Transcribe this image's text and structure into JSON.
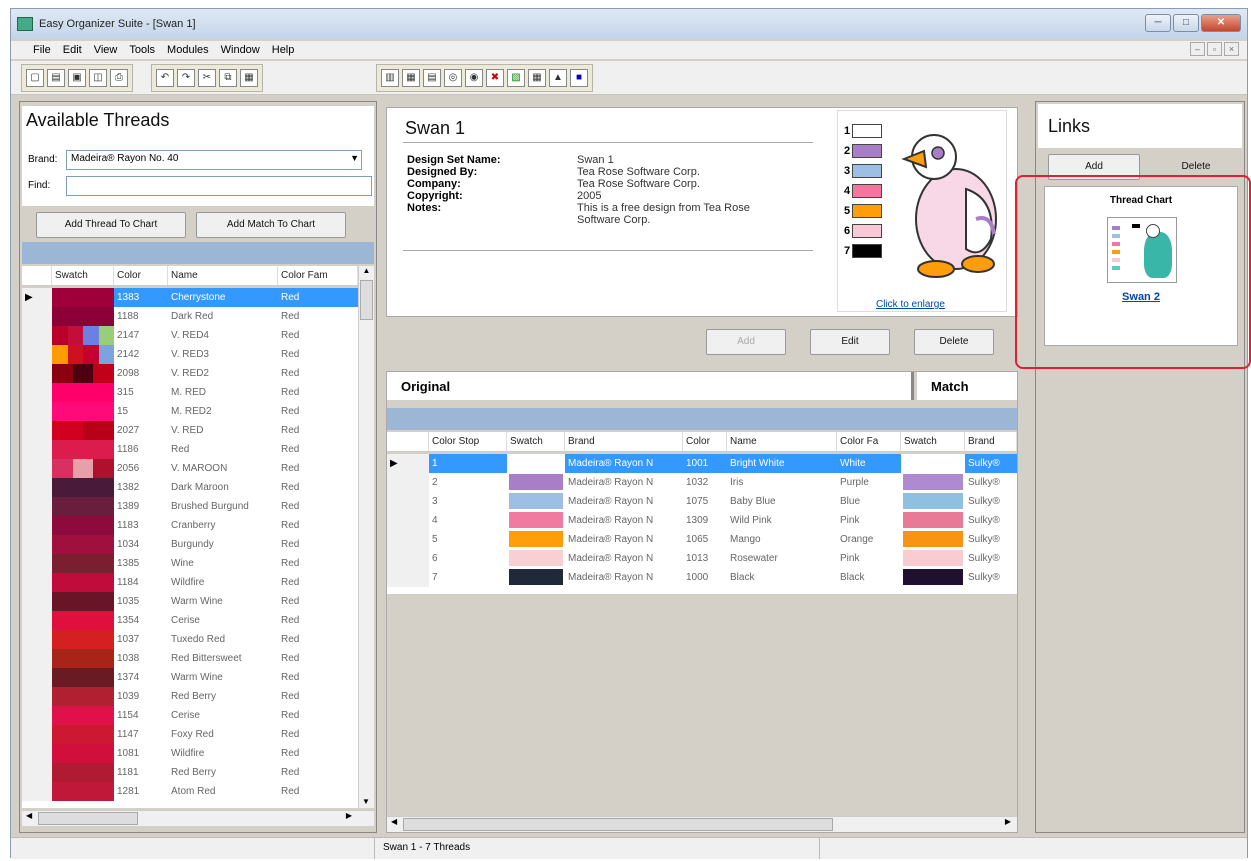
{
  "window": {
    "title": "Easy Organizer Suite - [Swan 1]"
  },
  "menu": [
    "File",
    "Edit",
    "View",
    "Tools",
    "Modules",
    "Window",
    "Help"
  ],
  "left": {
    "title": "Available Threads",
    "brand_label": "Brand:",
    "brand_value": "Madeira® Rayon No. 40",
    "find_label": "Find:",
    "add_thread": "Add Thread To Chart",
    "add_match": "Add Match To Chart",
    "columns": [
      "Swatch",
      "Color",
      "Name",
      "Color Fam"
    ],
    "rows": [
      {
        "swatch": [
          "#a0003a"
        ],
        "color": "1383",
        "name": "Cherrystone",
        "fam": "Red",
        "sel": true
      },
      {
        "swatch": [
          "#8c0038"
        ],
        "color": "1188",
        "name": "Dark Red",
        "fam": "Red"
      },
      {
        "swatch": [
          "#b8002a",
          "#c30d3a",
          "#6d7fe0",
          "#9acd79"
        ],
        "color": "2147",
        "name": "V. RED4",
        "fam": "Red"
      },
      {
        "swatch": [
          "#ff9a00",
          "#cf1020",
          "#c6002e",
          "#7aa3e0"
        ],
        "color": "2142",
        "name": "V. RED3",
        "fam": "Red"
      },
      {
        "swatch": [
          "#8b0010",
          "#4d0010",
          "#c00018"
        ],
        "color": "2098",
        "name": "V. RED2",
        "fam": "Red"
      },
      {
        "swatch": [
          "#ff006a"
        ],
        "color": "315",
        "name": "M. RED",
        "fam": "Red"
      },
      {
        "swatch": [
          "#ff0a78"
        ],
        "color": "15",
        "name": "M. RED2",
        "fam": "Red"
      },
      {
        "swatch": [
          "#d0001e",
          "#b80018"
        ],
        "color": "2027",
        "name": "V. RED",
        "fam": "Red"
      },
      {
        "swatch": [
          "#dd1c4e"
        ],
        "color": "1186",
        "name": "Red",
        "fam": "Red"
      },
      {
        "swatch": [
          "#d83060",
          "#e8a0a8",
          "#b0102c"
        ],
        "color": "2056",
        "name": "V. MAROON",
        "fam": "Red"
      },
      {
        "swatch": [
          "#4a1a3a"
        ],
        "color": "1382",
        "name": "Dark Maroon",
        "fam": "Red"
      },
      {
        "swatch": [
          "#6a1e3e"
        ],
        "color": "1389",
        "name": "Brushed Burgund",
        "fam": "Red"
      },
      {
        "swatch": [
          "#8e0a3c"
        ],
        "color": "1183",
        "name": "Cranberry",
        "fam": "Red"
      },
      {
        "swatch": [
          "#a0103e"
        ],
        "color": "1034",
        "name": "Burgundy",
        "fam": "Red"
      },
      {
        "swatch": [
          "#7a1e30"
        ],
        "color": "1385",
        "name": "Wine",
        "fam": "Red"
      },
      {
        "swatch": [
          "#c00c3a"
        ],
        "color": "1184",
        "name": "Wildfire",
        "fam": "Red"
      },
      {
        "swatch": [
          "#6a1428"
        ],
        "color": "1035",
        "name": "Warm Wine",
        "fam": "Red"
      },
      {
        "swatch": [
          "#e0103e"
        ],
        "color": "1354",
        "name": "Cerise",
        "fam": "Red"
      },
      {
        "swatch": [
          "#d42020"
        ],
        "color": "1037",
        "name": "Tuxedo Red",
        "fam": "Red"
      },
      {
        "swatch": [
          "#a82418"
        ],
        "color": "1038",
        "name": "Red Bittersweet",
        "fam": "Red"
      },
      {
        "swatch": [
          "#6a1a22"
        ],
        "color": "1374",
        "name": "Warm Wine",
        "fam": "Red"
      },
      {
        "swatch": [
          "#b02030"
        ],
        "color": "1039",
        "name": "Red Berry",
        "fam": "Red"
      },
      {
        "swatch": [
          "#e0104a"
        ],
        "color": "1154",
        "name": "Cerise",
        "fam": "Red"
      },
      {
        "swatch": [
          "#cc1830"
        ],
        "color": "1147",
        "name": "Foxy Red",
        "fam": "Red"
      },
      {
        "swatch": [
          "#d0103a"
        ],
        "color": "1081",
        "name": "Wildfire",
        "fam": "Red"
      },
      {
        "swatch": [
          "#b01a32"
        ],
        "color": "1181",
        "name": "Red Berry",
        "fam": "Red"
      },
      {
        "swatch": [
          "#c01838"
        ],
        "color": "1281",
        "name": "Atom Red",
        "fam": "Red"
      }
    ]
  },
  "design": {
    "title": "Swan 1",
    "labels": [
      "Design Set Name:",
      "Designed By:",
      "Company:",
      "Copyright:",
      "Notes:"
    ],
    "values": [
      "Swan 1",
      "Tea Rose Software Corp.",
      "Tea Rose Software Corp.",
      "2005",
      "This is a free design from Tea Rose Software Corp."
    ],
    "swatches": [
      {
        "n": "1",
        "c": "#ffffff"
      },
      {
        "n": "2",
        "c": "#a87ec8"
      },
      {
        "n": "3",
        "c": "#9ebfe4"
      },
      {
        "n": "4",
        "c": "#f477a0"
      },
      {
        "n": "5",
        "c": "#ff9d0a"
      },
      {
        "n": "6",
        "c": "#f8c8d6"
      },
      {
        "n": "7",
        "c": "#000000"
      }
    ],
    "enlarge": "Click to enlarge",
    "add": "Add",
    "edit": "Edit",
    "delete": "Delete"
  },
  "match": {
    "original": "Original",
    "match": "Match",
    "columns": [
      "Color Stop",
      "Swatch",
      "Brand",
      "Color",
      "Name",
      "Color Fa",
      "Swatch",
      "Brand"
    ],
    "rows": [
      {
        "stop": "1",
        "sw": "#ffffff",
        "brand": "Madeira® Rayon N",
        "color": "1001",
        "name": "Bright White",
        "fam": "White",
        "msw": "#ffffff",
        "mbrand": "Sulky®",
        "sel": true
      },
      {
        "stop": "2",
        "sw": "#a87ec8",
        "brand": "Madeira® Rayon N",
        "color": "1032",
        "name": "Iris",
        "fam": "Purple",
        "msw": "#b08ad0",
        "mbrand": "Sulky®"
      },
      {
        "stop": "3",
        "sw": "#9ebfe4",
        "brand": "Madeira® Rayon N",
        "color": "1075",
        "name": "Baby Blue",
        "fam": "Blue",
        "msw": "#90c0e0",
        "mbrand": "Sulky®"
      },
      {
        "stop": "4",
        "sw": "#f07aa0",
        "brand": "Madeira® Rayon N",
        "color": "1309",
        "name": "Wild Pink",
        "fam": "Pink",
        "msw": "#e87a98",
        "mbrand": "Sulky®"
      },
      {
        "stop": "5",
        "sw": "#ff9d0a",
        "brand": "Madeira® Rayon N",
        "color": "1065",
        "name": "Mango",
        "fam": "Orange",
        "msw": "#f89412",
        "mbrand": "Sulky®"
      },
      {
        "stop": "6",
        "sw": "#f8d0d4",
        "brand": "Madeira® Rayon N",
        "color": "1013",
        "name": "Rosewater",
        "fam": "Pink",
        "msw": "#f8ccd0",
        "mbrand": "Sulky®"
      },
      {
        "stop": "7",
        "sw": "#1e2a3a",
        "brand": "Madeira® Rayon N",
        "color": "1000",
        "name": "Black",
        "fam": "Black",
        "msw": "#201030",
        "mbrand": "Sulky®"
      }
    ]
  },
  "links": {
    "title": "Links",
    "add": "Add",
    "delete": "Delete",
    "chart_title": "Thread Chart",
    "chart_link": "Swan 2"
  },
  "status": {
    "text": "Swan 1 - 7 Threads"
  }
}
